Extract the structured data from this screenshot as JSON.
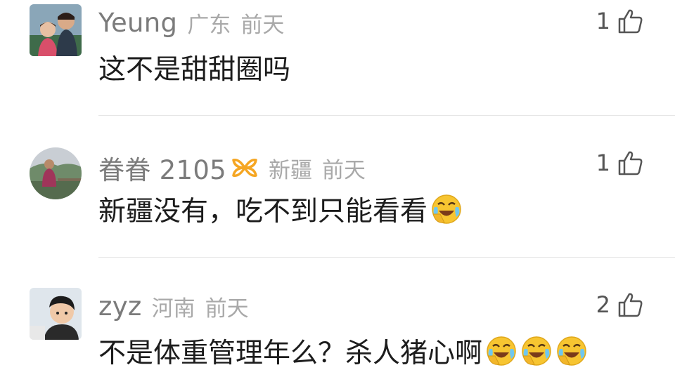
{
  "comments": [
    {
      "username": "Yeung",
      "location": "广东",
      "time": "前天",
      "text": "这不是甜甜圈吗",
      "likes": "1",
      "avatar_type": "photo-square",
      "emoji_count": 0
    },
    {
      "username": "眷眷 2105",
      "location": "新疆",
      "time": "前天",
      "text": "新疆没有，吃不到只能看看",
      "likes": "1",
      "avatar_type": "photo-round",
      "badge_icon": "vip-badge-icon",
      "emoji_count": 1
    },
    {
      "username": "zyz",
      "location": "河南",
      "time": "前天",
      "text": "不是体重管理年么？杀人猪心啊",
      "likes": "2",
      "avatar_type": "photo-square",
      "emoji_count": 3
    }
  ],
  "icons": {
    "like": "thumbs-up-icon",
    "emoji": "laughing-crying-emoji-icon",
    "badge": "vip-badge-icon"
  },
  "colors": {
    "username": "#7b7b7b",
    "meta": "#a9a9a9",
    "text": "#1c1c1c",
    "badge": "#f5a623",
    "emoji": "#f7c531"
  }
}
